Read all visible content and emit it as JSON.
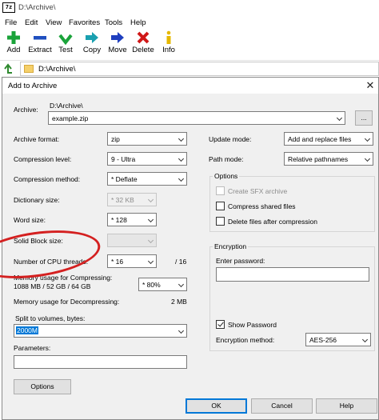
{
  "window": {
    "app_icon_text": "7z",
    "title": "D:\\Archive\\"
  },
  "menu": [
    "File",
    "Edit",
    "View",
    "Favorites",
    "Tools",
    "Help"
  ],
  "toolbar": {
    "add": "Add",
    "extract": "Extract",
    "test": "Test",
    "copy": "Copy",
    "move": "Move",
    "delete": "Delete",
    "info": "Info"
  },
  "address": {
    "path": "D:\\Archive\\"
  },
  "dialog": {
    "title": "Add to Archive",
    "close": "✕",
    "archive_label": "Archive:",
    "archive_dir": "D:\\Archive\\",
    "archive_name": "example.zip",
    "browse_button": "...",
    "archive_format_label": "Archive format:",
    "archive_format": "zip",
    "compression_level_label": "Compression level:",
    "compression_level": "9 - Ultra",
    "compression_method_label": "Compression method:",
    "compression_method": "* Deflate",
    "dictionary_size_label": "Dictionary size:",
    "dictionary_size": "* 32 KB",
    "word_size_label": "Word size:",
    "word_size": "* 128",
    "solid_block_label": "Solid Block size:",
    "solid_block": "",
    "cpu_threads_label": "Number of CPU threads:",
    "cpu_threads": "* 16",
    "cpu_threads_max": "/ 16",
    "mem_compress_label_1": "Memory usage for Compressing:",
    "mem_compress_label_2": "1088 MB / 52 GB / 64 GB",
    "mem_compress": "* 80%",
    "mem_decompress_label": "Memory usage for Decompressing:",
    "mem_decompress": "2 MB",
    "split_label": "Split to volumes, bytes:",
    "split_value": "2000M",
    "parameters_label": "Parameters:",
    "parameters_value": "",
    "options_button": "Options",
    "update_mode_label": "Update mode:",
    "update_mode": "Add and replace files",
    "path_mode_label": "Path mode:",
    "path_mode": "Relative pathnames",
    "options_group": "Options",
    "create_sfx": "Create SFX archive",
    "compress_shared": "Compress shared files",
    "delete_after": "Delete files after compression",
    "encryption_group": "Encryption",
    "enter_password_label": "Enter password:",
    "password_value": "",
    "show_password": "Show Password",
    "show_password_checked": true,
    "encryption_method_label": "Encryption method:",
    "encryption_method": "AES-256",
    "ok_button": "OK",
    "cancel_button": "Cancel",
    "help_button": "Help"
  },
  "colors": {
    "add": "#1aa33a",
    "extract": "#1f4fbf",
    "test": "#1aa33a",
    "copy": "#1aa0b0",
    "move": "#1f3fbf",
    "delete": "#d01818",
    "info": "#e6b800",
    "annotation": "#d42020"
  }
}
